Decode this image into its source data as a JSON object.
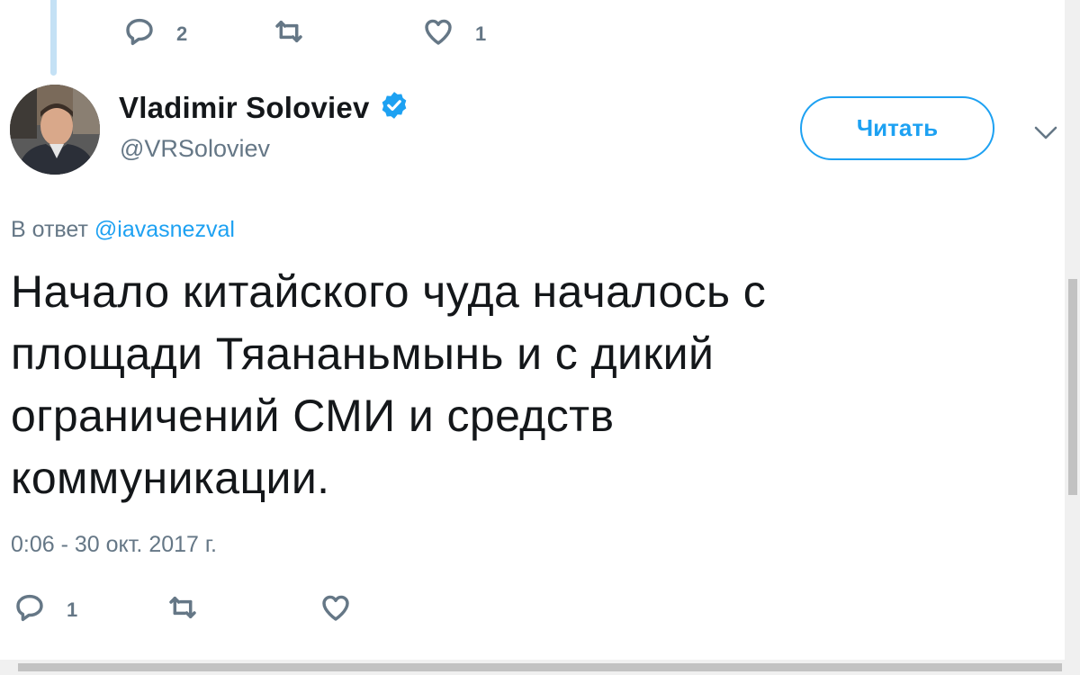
{
  "previous_tweet": {
    "actions": {
      "reply_count": "2",
      "retweet_count": "",
      "like_count": "1"
    }
  },
  "tweet": {
    "author": {
      "name": "Vladimir Soloviev",
      "handle": "@VRSoloviev",
      "verified": true
    },
    "follow_button_label": "Читать",
    "reply_prefix": "В ответ",
    "reply_mention": "@iavasnezval",
    "text_lines": [
      "Начало китайского чуда началось с",
      "площади Тяананьмынь и с дикий",
      "ограничений СМИ и средств",
      "коммуникации."
    ],
    "timestamp": "0:06 - 30 окт. 2017 г.",
    "actions": {
      "reply_count": "1",
      "retweet_count": "",
      "like_count": ""
    }
  },
  "icons": {
    "reply": "reply-icon",
    "retweet": "retweet-icon",
    "like": "heart-icon",
    "verified": "verified-badge-icon",
    "caret": "chevron-down-icon"
  },
  "colors": {
    "accent": "#1da1f2",
    "secondary_text": "#657786",
    "primary_text": "#14171a",
    "thread_line": "#c4e1f5"
  }
}
